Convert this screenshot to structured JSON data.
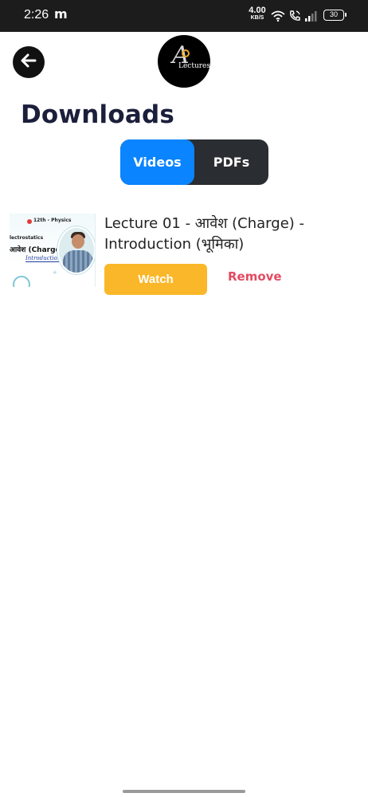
{
  "status_bar": {
    "time": "2:26",
    "notification_letter": "m",
    "net_speed_value": "4.00",
    "net_speed_unit": "KB/S",
    "battery_level": "30",
    "icons": [
      "wifi-icon",
      "call-icon",
      "signal-icon",
      "battery-icon"
    ]
  },
  "header": {
    "back_icon": "arrow-left-icon",
    "logo_letter": "A",
    "logo_text": "Lectures"
  },
  "page": {
    "title": "Downloads"
  },
  "tabs": {
    "items": [
      {
        "label": "Videos",
        "active": true
      },
      {
        "label": "PDFs",
        "active": false
      }
    ],
    "active_color": "#0a84ff",
    "inactive_color": "#2a2d31"
  },
  "downloads": [
    {
      "thumbnail": {
        "class_label": "12th - Physics",
        "subject": "lectrostatics",
        "topic": "आवेश (Charge)",
        "subtitle": "Introduction"
      },
      "title": "Lecture 01 - आवेश (Charge) - Introduction (भूमिका)",
      "watch_label": "Watch",
      "remove_label": "Remove"
    }
  ],
  "colors": {
    "watch_button": "#fbb72a",
    "remove_text": "#e34b63",
    "title_text": "#1b1f3b"
  }
}
